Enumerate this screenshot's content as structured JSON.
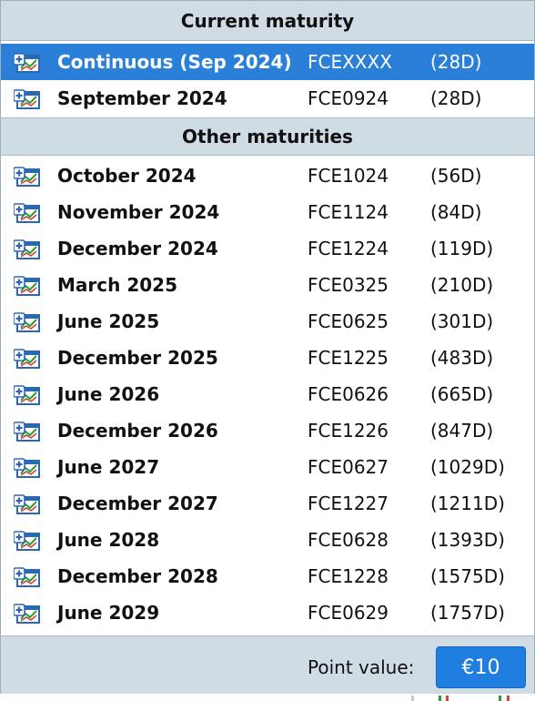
{
  "sections": {
    "current": "Current maturity",
    "other": "Other maturities"
  },
  "current_rows": [
    {
      "name": "Continuous (Sep 2024)",
      "code": "FCEXXXX",
      "days": "(28D)",
      "selected": true,
      "icon": "chart-add-icon"
    },
    {
      "name": "September 2024",
      "code": "FCE0924",
      "days": "(28D)",
      "selected": false,
      "icon": "chart-add-icon"
    }
  ],
  "other_rows": [
    {
      "name": "October 2024",
      "code": "FCE1024",
      "days": "(56D)",
      "icon": "chart-add-icon"
    },
    {
      "name": "November 2024",
      "code": "FCE1124",
      "days": "(84D)",
      "icon": "chart-add-icon"
    },
    {
      "name": "December 2024",
      "code": "FCE1224",
      "days": "(119D)",
      "icon": "chart-add-icon"
    },
    {
      "name": "March 2025",
      "code": "FCE0325",
      "days": "(210D)",
      "icon": "chart-add-icon"
    },
    {
      "name": "June 2025",
      "code": "FCE0625",
      "days": "(301D)",
      "icon": "chart-add-icon"
    },
    {
      "name": "December 2025",
      "code": "FCE1225",
      "days": "(483D)",
      "icon": "chart-add-icon"
    },
    {
      "name": "June 2026",
      "code": "FCE0626",
      "days": "(665D)",
      "icon": "chart-add-icon"
    },
    {
      "name": "December 2026",
      "code": "FCE1226",
      "days": "(847D)",
      "icon": "chart-add-icon"
    },
    {
      "name": "June 2027",
      "code": "FCE0627",
      "days": "(1029D)",
      "icon": "chart-add-icon"
    },
    {
      "name": "December 2027",
      "code": "FCE1227",
      "days": "(1211D)",
      "icon": "chart-add-icon"
    },
    {
      "name": "June 2028",
      "code": "FCE0628",
      "days": "(1393D)",
      "icon": "chart-add-icon"
    },
    {
      "name": "December 2028",
      "code": "FCE1228",
      "days": "(1575D)",
      "icon": "chart-add-icon"
    },
    {
      "name": "June 2029",
      "code": "FCE0629",
      "days": "(1757D)",
      "icon": "chart-add-icon"
    }
  ],
  "footer": {
    "point_value_label": "Point value:",
    "point_value": "€10"
  },
  "colors": {
    "selected_bg": "#2a7fd9",
    "header_bg": "#cfdce4",
    "button_bg": "#1f7ee0"
  }
}
